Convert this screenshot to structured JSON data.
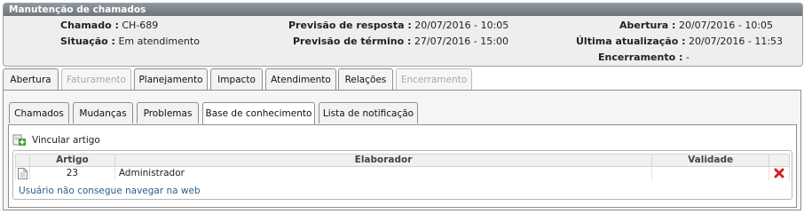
{
  "panel": {
    "title": "Manutenção de chamados",
    "chamado_label": "Chamado :",
    "chamado_value": "CH-689",
    "situacao_label": "Situação :",
    "situacao_value": "Em atendimento",
    "prev_resposta_label": "Previsão de resposta :",
    "prev_resposta_value": "20/07/2016 - 10:05",
    "prev_termino_label": "Previsão de término :",
    "prev_termino_value": "27/07/2016 - 15:00",
    "abertura_label": "Abertura :",
    "abertura_value": "20/07/2016 - 10:05",
    "ultima_label": "Última atualização :",
    "ultima_value": "20/07/2016 - 11:53",
    "encerramento_label": "Encerramento :",
    "encerramento_value": "-"
  },
  "tabs": [
    {
      "label": "Abertura",
      "state": "normal"
    },
    {
      "label": "Faturamento",
      "state": "disabled"
    },
    {
      "label": "Planejamento",
      "state": "normal"
    },
    {
      "label": "Impacto",
      "state": "normal"
    },
    {
      "label": "Atendimento",
      "state": "normal"
    },
    {
      "label": "Relações",
      "state": "active"
    },
    {
      "label": "Encerramento",
      "state": "disabled"
    }
  ],
  "subtabs": [
    {
      "label": "Chamados"
    },
    {
      "label": "Mudanças"
    },
    {
      "label": "Problemas"
    },
    {
      "label": "Base de conhecimento",
      "active": true
    },
    {
      "label": "Lista de notificação"
    }
  ],
  "vincular": {
    "label": "Vincular artigo",
    "icon": "add-link-icon"
  },
  "table": {
    "headers": [
      "Artigo",
      "Elaborador",
      "Validade"
    ],
    "rows": [
      {
        "artigo": "23",
        "elaborador": "Administrador",
        "validade": "",
        "title": "Usuário não consegue navegar na web"
      }
    ]
  },
  "colors": {
    "header": "#7a8289",
    "link": "#2a5d8c",
    "delete": "#d62020"
  }
}
